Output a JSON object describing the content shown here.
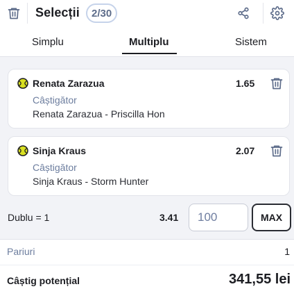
{
  "header": {
    "title": "Selecții",
    "count": "2/30",
    "icons": [
      "trash-icon",
      "share-icon",
      "gear-icon"
    ]
  },
  "tabs": [
    {
      "label": "Simplu",
      "active": false
    },
    {
      "label": "Multiplu",
      "active": true
    },
    {
      "label": "Sistem",
      "active": false
    }
  ],
  "selections": [
    {
      "player": "Renata Zarazua",
      "odds": "1.65",
      "market": "Câștigător",
      "event": "Renata Zarazua - Priscilla Hon",
      "icon": "tennis-ball-icon"
    },
    {
      "player": "Sinja Kraus",
      "odds": "2.07",
      "market": "Câștigător",
      "event": "Sinja Kraus - Storm Hunter",
      "icon": "tennis-ball-icon"
    }
  ],
  "bet": {
    "label": "Dublu = 1",
    "total_odds": "3.41",
    "stake_value": "100",
    "max_label": "MAX"
  },
  "summary": {
    "pariuri_label": "Pariuri",
    "pariuri_value": "1",
    "castig_label": "Câștig potențial",
    "castig_value": "341,55 lei"
  },
  "colors": {
    "accent": "#1c1d22",
    "muted_text": "#6c7d9e",
    "ball_yellow": "#d9e021",
    "page_bg": "#f2f3f7"
  }
}
